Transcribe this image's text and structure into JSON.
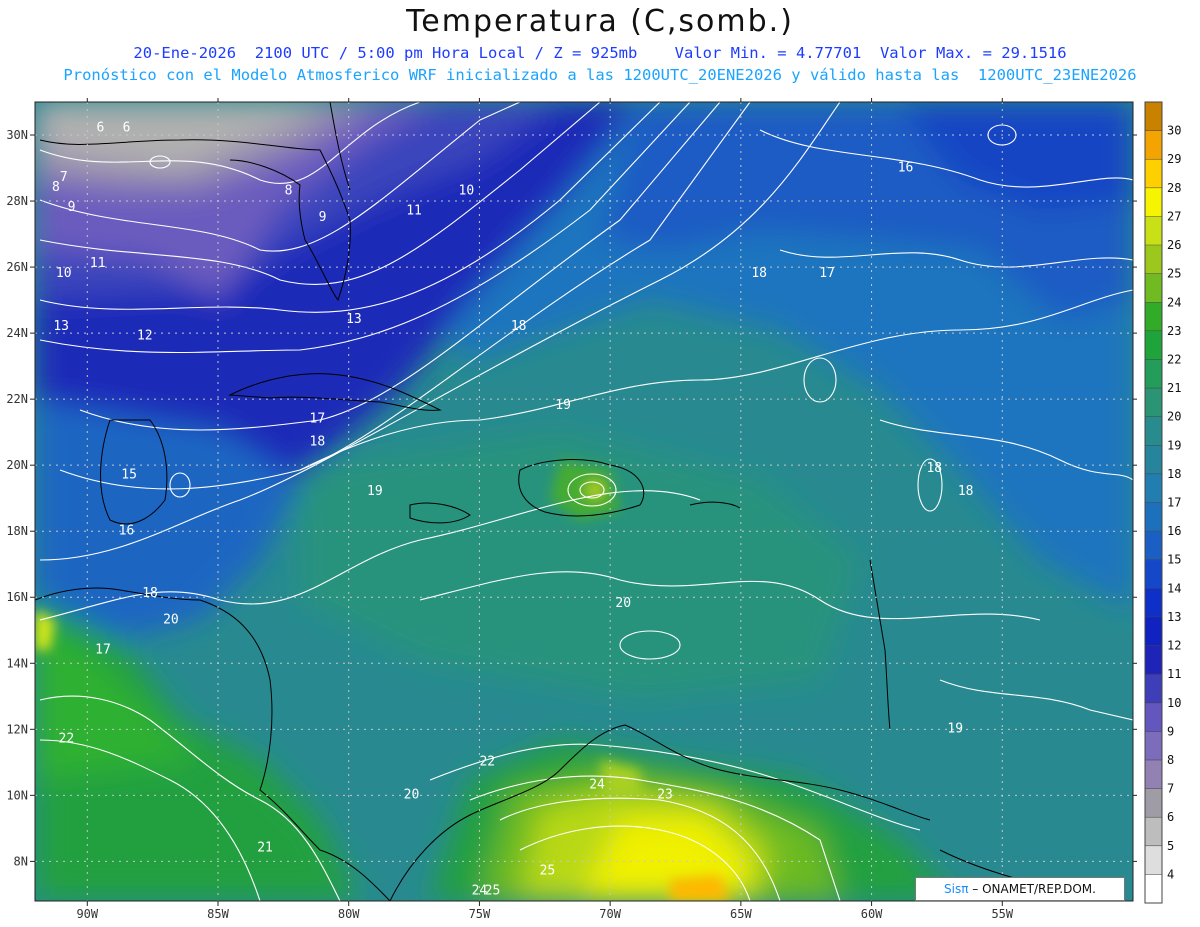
{
  "header": {
    "title": "Temperatura (C,somb.)",
    "line1": "20-Ene-2026  2100 UTC / 5:00 pm Hora Local / Z = 925mb    Valor Min. = 4.77701  Valor Max. = 29.1516",
    "line2": "Pronóstico con el Modelo Atmosferico WRF inicializado a las 1200UTC_20ENE2026 y válido hasta las  1200UTC_23ENE2026"
  },
  "map": {
    "lon_range": [
      -92,
      -50
    ],
    "lat_range": [
      6.8,
      31
    ],
    "lon_ticks": [
      {
        "value": -90,
        "label": "90W"
      },
      {
        "value": -85,
        "label": "85W"
      },
      {
        "value": -80,
        "label": "80W"
      },
      {
        "value": -75,
        "label": "75W"
      },
      {
        "value": -70,
        "label": "70W"
      },
      {
        "value": -65,
        "label": "65W"
      },
      {
        "value": -60,
        "label": "60W"
      },
      {
        "value": -55,
        "label": "55W"
      }
    ],
    "lat_ticks": [
      {
        "value": 30,
        "label": "30N"
      },
      {
        "value": 28,
        "label": "28N"
      },
      {
        "value": 26,
        "label": "26N"
      },
      {
        "value": 24,
        "label": "24N"
      },
      {
        "value": 22,
        "label": "22N"
      },
      {
        "value": 20,
        "label": "20N"
      },
      {
        "value": 18,
        "label": "18N"
      },
      {
        "value": 16,
        "label": "16N"
      },
      {
        "value": 14,
        "label": "14N"
      },
      {
        "value": 12,
        "label": "12N"
      },
      {
        "value": 10,
        "label": "10N"
      },
      {
        "value": 8,
        "label": "8N"
      }
    ],
    "contour_labels": [
      {
        "lon": -89.5,
        "lat": 30.1,
        "text": "6"
      },
      {
        "lon": -88.5,
        "lat": 30.1,
        "text": "6"
      },
      {
        "lon": -90.9,
        "lat": 28.6,
        "text": "7"
      },
      {
        "lon": -91.2,
        "lat": 28.3,
        "text": "8"
      },
      {
        "lon": -90.6,
        "lat": 27.7,
        "text": "9"
      },
      {
        "lon": -90.9,
        "lat": 25.7,
        "text": "10"
      },
      {
        "lon": -89.6,
        "lat": 26.0,
        "text": "11"
      },
      {
        "lon": -82.3,
        "lat": 28.2,
        "text": "8"
      },
      {
        "lon": -81.0,
        "lat": 27.4,
        "text": "9"
      },
      {
        "lon": -75.5,
        "lat": 28.2,
        "text": "10"
      },
      {
        "lon": -77.5,
        "lat": 27.6,
        "text": "11"
      },
      {
        "lon": -91.0,
        "lat": 24.1,
        "text": "13"
      },
      {
        "lon": -87.8,
        "lat": 23.8,
        "text": "12"
      },
      {
        "lon": -79.8,
        "lat": 24.3,
        "text": "13"
      },
      {
        "lon": -81.2,
        "lat": 21.3,
        "text": "17"
      },
      {
        "lon": -81.2,
        "lat": 20.6,
        "text": "18"
      },
      {
        "lon": -88.4,
        "lat": 19.6,
        "text": "15"
      },
      {
        "lon": -88.5,
        "lat": 17.9,
        "text": "16"
      },
      {
        "lon": -79.0,
        "lat": 19.1,
        "text": "19"
      },
      {
        "lon": -87.6,
        "lat": 16.0,
        "text": "18"
      },
      {
        "lon": -89.4,
        "lat": 14.3,
        "text": "17"
      },
      {
        "lon": -86.8,
        "lat": 15.2,
        "text": "20"
      },
      {
        "lon": -90.8,
        "lat": 11.6,
        "text": "22"
      },
      {
        "lon": -77.6,
        "lat": 9.9,
        "text": "20"
      },
      {
        "lon": -83.2,
        "lat": 8.3,
        "text": "21"
      },
      {
        "lon": -71.8,
        "lat": 21.7,
        "text": "19"
      },
      {
        "lon": -74.7,
        "lat": 10.9,
        "text": "22"
      },
      {
        "lon": -67.9,
        "lat": 9.9,
        "text": "23"
      },
      {
        "lon": -70.5,
        "lat": 10.2,
        "text": "24"
      },
      {
        "lon": -72.4,
        "lat": 7.6,
        "text": "25"
      },
      {
        "lon": -75.0,
        "lat": 7.0,
        "text": "24"
      },
      {
        "lon": -74.5,
        "lat": 7.0,
        "text": "25"
      },
      {
        "lon": -69.5,
        "lat": 15.7,
        "text": "20"
      },
      {
        "lon": -64.3,
        "lat": 25.7,
        "text": "18"
      },
      {
        "lon": -73.5,
        "lat": 24.1,
        "text": "18"
      },
      {
        "lon": -61.7,
        "lat": 25.7,
        "text": "17"
      },
      {
        "lon": -58.7,
        "lat": 28.9,
        "text": "16"
      },
      {
        "lon": -57.6,
        "lat": 19.8,
        "text": "18"
      },
      {
        "lon": -56.4,
        "lat": 19.1,
        "text": "18"
      },
      {
        "lon": -56.8,
        "lat": 11.9,
        "text": "19"
      }
    ]
  },
  "colorbar": {
    "labels": [
      "4",
      "5",
      "6",
      "7",
      "8",
      "9",
      "10",
      "11",
      "12",
      "13",
      "14",
      "15",
      "16",
      "17",
      "18",
      "19",
      "20",
      "21",
      "22",
      "23",
      "24",
      "25",
      "26",
      "27",
      "28",
      "29",
      "30"
    ],
    "colors": [
      "#ffffff",
      "#dedede",
      "#bdbdbd",
      "#a09ca6",
      "#9282b4",
      "#7d6cbc",
      "#6356be",
      "#3e3eb8",
      "#1e24b8",
      "#1022c0",
      "#0f30c8",
      "#1548c8",
      "#1b5ec4",
      "#1d70bc",
      "#227eb0",
      "#26849c",
      "#288c8e",
      "#2a9474",
      "#249c5a",
      "#1fa43c",
      "#32ac28",
      "#70ba22",
      "#9cc81e",
      "#c8e016",
      "#f6f400",
      "#ffd000",
      "#f4a400",
      "#c88200"
    ]
  },
  "credit": {
    "brand": "Sisπ",
    "org": "– ONAMET/REP.DOM."
  }
}
